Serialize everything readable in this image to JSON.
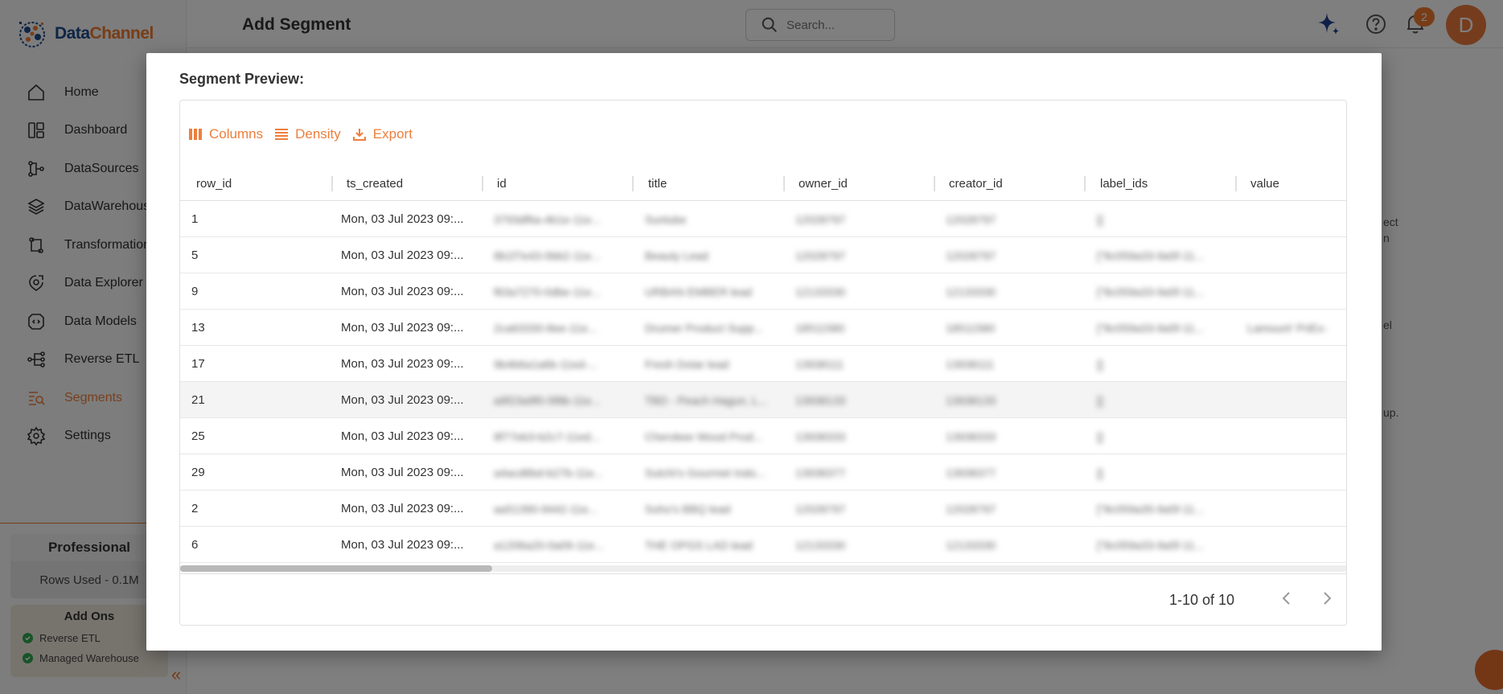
{
  "brand": {
    "name_part1": "Data",
    "name_part2": "Channel"
  },
  "sidebar": {
    "items": [
      {
        "label": "Home",
        "icon": "home-icon"
      },
      {
        "label": "Dashboard",
        "icon": "dashboard-icon"
      },
      {
        "label": "DataSources",
        "icon": "datasources-icon"
      },
      {
        "label": "DataWarehouse",
        "icon": "layers-icon"
      },
      {
        "label": "Transformations",
        "icon": "transform-icon"
      },
      {
        "label": "Data Explorer",
        "icon": "explorer-icon"
      },
      {
        "label": "Data Models",
        "icon": "models-icon"
      },
      {
        "label": "Reverse ETL",
        "icon": "reverse-etl-icon"
      },
      {
        "label": "Segments",
        "icon": "segments-icon",
        "active": true
      },
      {
        "label": "Settings",
        "icon": "gear-icon"
      }
    ],
    "plan": {
      "name": "Professional",
      "rows_used": "Rows Used - 0.1M"
    },
    "addons": {
      "title": "Add Ons",
      "items": [
        "Reverse ETL",
        "Managed Warehouse"
      ]
    }
  },
  "header": {
    "title": "Add Segment",
    "search_placeholder": "Search...",
    "notification_count": "2",
    "avatar_initial": "D"
  },
  "background_fragments": [
    "ect",
    "n",
    "el",
    "up."
  ],
  "modal": {
    "title": "Segment Preview:",
    "toolbar": {
      "columns": "Columns",
      "density": "Density",
      "export": "Export"
    },
    "columns": [
      "row_id",
      "ts_created",
      "id",
      "title",
      "owner_id",
      "creator_id",
      "label_ids",
      "value"
    ],
    "rows": [
      {
        "row_id": "1",
        "ts_created": "Mon, 03 Jul 2023 09:...",
        "id": "3793df6a-4b1e-11e...",
        "title": "Sunlube",
        "owner_id": "12028797",
        "creator_id": "12028797",
        "label_ids": "[]",
        "value": ""
      },
      {
        "row_id": "5",
        "ts_created": "Mon, 03 Jul 2023 09:...",
        "id": "8b1f7e43-0bb2-11e...",
        "title": "Beauty Lead",
        "owner_id": "12028797",
        "creator_id": "12028797",
        "label_ids": "[\"8c059a33-9a5f-11...",
        "value": ""
      },
      {
        "row_id": "9",
        "ts_created": "Mon, 03 Jul 2023 09:...",
        "id": "f63a7270-0dbe-11e...",
        "title": "URBAN EMBER lead",
        "owner_id": "12133330",
        "creator_id": "12133330",
        "label_ids": "[\"8c059a33-9a5f-11...",
        "value": ""
      },
      {
        "row_id": "13",
        "ts_created": "Mon, 03 Jul 2023 09:...",
        "id": "2ca63330-8ee-11e...",
        "title": "Drumer Product Supp...",
        "owner_id": "18511580",
        "creator_id": "18511580",
        "label_ids": "[\"8c059a33-9a5f-11...",
        "value": "Lamount' PriEx-"
      },
      {
        "row_id": "17",
        "ts_created": "Mon, 03 Jul 2023 09:...",
        "id": "9b4b6a1a6b-11ed-...",
        "title": "Fresh Dotar lead",
        "owner_id": "13938111",
        "creator_id": "13938111",
        "label_ids": "[]",
        "value": ""
      },
      {
        "row_id": "21",
        "ts_created": "Mon, 03 Jul 2023 09:...",
        "id": "a9f23a9f0-5f8b-11e...",
        "title": "TBD - Peach Hagun, L...",
        "owner_id": "13938133",
        "creator_id": "13938133",
        "label_ids": "[]",
        "value": ""
      },
      {
        "row_id": "25",
        "ts_created": "Mon, 03 Jul 2023 09:...",
        "id": "8f77eb3-b2c7-11ed...",
        "title": "Cherokee Wood Prod...",
        "owner_id": "13938333",
        "creator_id": "13938333",
        "label_ids": "[]",
        "value": ""
      },
      {
        "row_id": "29",
        "ts_created": "Mon, 03 Jul 2023 09:...",
        "id": "a4acd6bd-b27b-11e...",
        "title": "Sutchi's Gourmet Indo...",
        "owner_id": "13938377",
        "creator_id": "13938377",
        "label_ids": "[]",
        "value": ""
      },
      {
        "row_id": "2",
        "ts_created": "Mon, 03 Jul 2023 09:...",
        "id": "aa51390-9442-11e...",
        "title": "Soho's BBQ lead",
        "owner_id": "12028797",
        "creator_id": "12028797",
        "label_ids": "[\"8c059a35-9a5f-11...",
        "value": ""
      },
      {
        "row_id": "6",
        "ts_created": "Mon, 03 Jul 2023 09:...",
        "id": "a1206a20-0a09-11e...",
        "title": "THE OPGS LAD lead",
        "owner_id": "12133330",
        "creator_id": "12133330",
        "label_ids": "[\"8c059a33-9a5f-11...",
        "value": ""
      }
    ],
    "pagination": {
      "range": "1-10 of 10"
    }
  },
  "colors": {
    "accent": "#ee7f3c",
    "brand_blue": "#1f4a8c",
    "addon_check": "#2fa84f"
  }
}
